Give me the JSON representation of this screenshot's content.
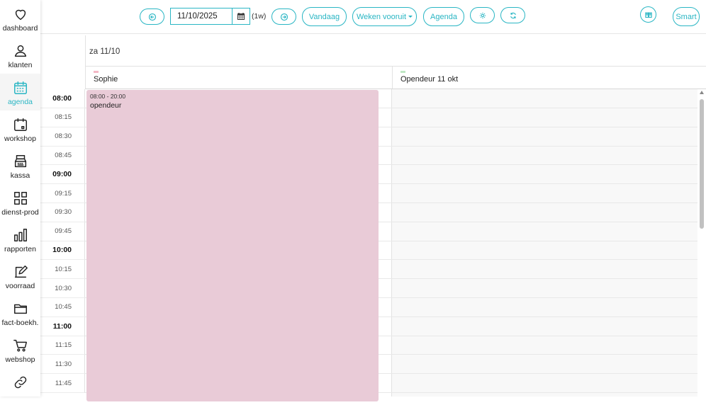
{
  "sidebar": {
    "items": [
      {
        "label": "dashboard",
        "icon": "heart-icon"
      },
      {
        "label": "klanten",
        "icon": "user-icon"
      },
      {
        "label": "agenda",
        "icon": "calendar-icon",
        "active": true
      },
      {
        "label": "workshop",
        "icon": "workshop-calendar-icon"
      },
      {
        "label": "kassa",
        "icon": "cash-register-icon"
      },
      {
        "label": "dienst-prod",
        "icon": "grid-icon"
      },
      {
        "label": "rapporten",
        "icon": "bar-chart-icon"
      },
      {
        "label": "voorraad",
        "icon": "edit-icon"
      },
      {
        "label": "fact-boekh.",
        "icon": "folder-icon"
      },
      {
        "label": "webshop",
        "icon": "cart-icon"
      },
      {
        "label": "",
        "icon": "link-icon"
      }
    ]
  },
  "toolbar": {
    "date_value": "11/10/2025",
    "week_tag": "(1w)",
    "today_label": "Vandaag",
    "weeks_ahead_label": "Weken vooruit",
    "agenda_label": "Agenda",
    "smart_label": "Smart"
  },
  "calendar": {
    "day_label": "za 11/10",
    "resources": [
      {
        "name": "Sophie",
        "color": "#f4b8c6"
      },
      {
        "name": "Opendeur 11 okt",
        "color": "#bfe7c4"
      }
    ],
    "time_slots": [
      "08:00",
      "08:15",
      "08:30",
      "08:45",
      "09:00",
      "09:15",
      "09:30",
      "09:45",
      "10:00",
      "10:15",
      "10:30",
      "10:45",
      "11:00",
      "11:15",
      "11:30",
      "11:45"
    ],
    "event": {
      "time": "08:00 - 20:00",
      "title": "opendeur",
      "color": "#e9cbd7"
    }
  },
  "colors": {
    "accent": "#2ab6c4"
  }
}
